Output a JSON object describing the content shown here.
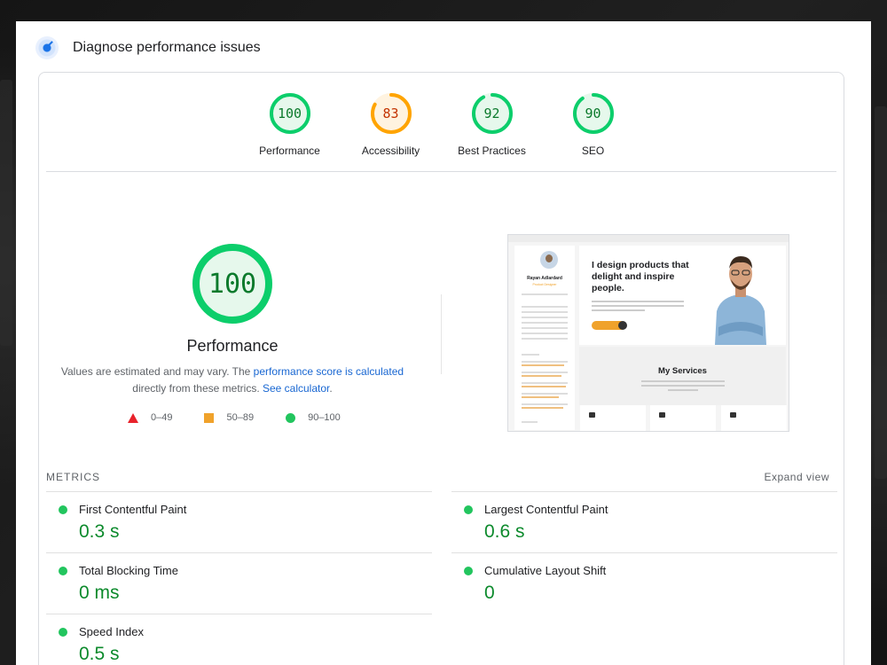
{
  "header": {
    "title": "Diagnose performance issues"
  },
  "gauges": [
    {
      "score": "100",
      "label": "Performance",
      "value": 100,
      "color": "#0cce6b",
      "text_color": "#0c7a2c",
      "bg": "#e6f8ec"
    },
    {
      "score": "83",
      "label": "Accessibility",
      "value": 83,
      "color": "#ffa400",
      "text_color": "#c33300",
      "bg": "#fff3e0"
    },
    {
      "score": "92",
      "label": "Best Practices",
      "value": 92,
      "color": "#0cce6b",
      "text_color": "#0c7a2c",
      "bg": "#e6f8ec"
    },
    {
      "score": "90",
      "label": "SEO",
      "value": 90,
      "color": "#0cce6b",
      "text_color": "#0c7a2c",
      "bg": "#e6f8ec"
    }
  ],
  "main": {
    "score": "100",
    "label": "Performance",
    "desc_prefix": "Values are estimated and may vary. The ",
    "desc_link1": "performance score is calculated",
    "desc_middle": " directly from these metrics. ",
    "desc_link2": "See calculator",
    "desc_suffix": "."
  },
  "legend": [
    {
      "shape": "triangle",
      "range": "0–49",
      "color": "#e8222b"
    },
    {
      "shape": "square",
      "range": "50–89",
      "color": "#f0a22b"
    },
    {
      "shape": "circle",
      "range": "90–100",
      "color": "#22c55e"
    }
  ],
  "screenshot": {
    "name": "Rayan Adlardard",
    "role": "Product Designer",
    "hero_title": "I design products that delight and inspire people.",
    "services_title": "My Services"
  },
  "metrics": {
    "title": "METRICS",
    "expand": "Expand view",
    "items": [
      {
        "name": "First Contentful Paint",
        "value": "0.3 s"
      },
      {
        "name": "Largest Contentful Paint",
        "value": "0.6 s"
      },
      {
        "name": "Total Blocking Time",
        "value": "0 ms"
      },
      {
        "name": "Cumulative Layout Shift",
        "value": "0"
      },
      {
        "name": "Speed Index",
        "value": "0.5 s"
      }
    ]
  }
}
